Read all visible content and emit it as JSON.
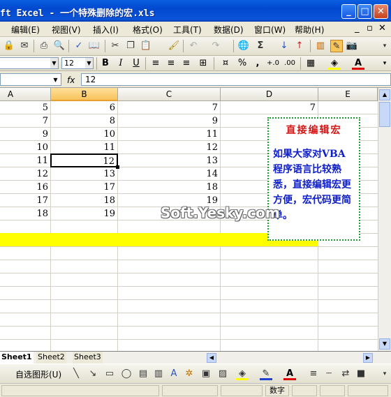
{
  "window": {
    "title": "ft Excel - 一个特殊删除的宏.xls",
    "controls": [
      "_",
      "□",
      "✕"
    ]
  },
  "menubar": {
    "items": [
      "编辑(E)",
      "视图(V)",
      "插入(I)",
      "格式(O)",
      "工具(T)",
      "数据(D)",
      "窗口(W)",
      "帮助(H)"
    ],
    "right": [
      "_",
      "▫",
      "✕"
    ]
  },
  "toolbar2": {
    "font_size": "12",
    "bold": "B",
    "italic": "I",
    "underline": "U",
    "percent": "%",
    "comma": ","
  },
  "formula_bar": {
    "fx": "fx",
    "value": "12"
  },
  "columns": [
    "A",
    "B",
    "C",
    "D",
    "E"
  ],
  "rows": [
    [
      "5",
      "6",
      "7",
      "7"
    ],
    [
      "7",
      "8",
      "9",
      ""
    ],
    [
      "9",
      "10",
      "11",
      ""
    ],
    [
      "10",
      "11",
      "12",
      ""
    ],
    [
      "11",
      "12",
      "13",
      ""
    ],
    [
      "12",
      "13",
      "14",
      ""
    ],
    [
      "16",
      "17",
      "18",
      ""
    ],
    [
      "17",
      "18",
      "19",
      ""
    ],
    [
      "18",
      "19",
      "",
      ""
    ]
  ],
  "note": {
    "title": "直接编辑宏",
    "body": "如果大家对VBA程序语言比较熟悉，直接编辑宏更方便，宏代码更简单。"
  },
  "watermark": "Soft.Yesky.com",
  "sheets": [
    "Sheet1",
    "Sheet2",
    "Sheet3"
  ],
  "drawing_toolbar": {
    "autoshapes": "自选图形(U)"
  },
  "status": {
    "mode": "数字"
  },
  "colors": {
    "highlight_row": "#ffff00",
    "selected_col": "#f8c35c",
    "note_border": "#1d9a2c",
    "note_title": "#d01818",
    "note_body": "#1020c8"
  }
}
